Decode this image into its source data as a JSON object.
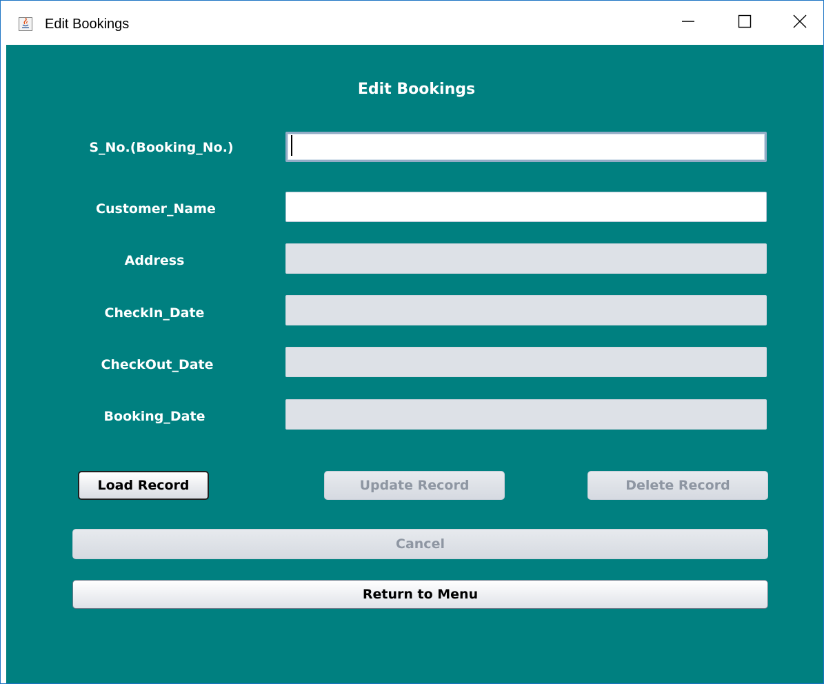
{
  "window": {
    "title": "Edit Bookings"
  },
  "form": {
    "heading": "Edit Bookings",
    "fields": [
      {
        "label": "S_No.(Booking_No.)",
        "value": ""
      },
      {
        "label": "Customer_Name",
        "value": ""
      },
      {
        "label": "Address",
        "value": ""
      },
      {
        "label": "CheckIn_Date",
        "value": ""
      },
      {
        "label": "CheckOut_Date",
        "value": ""
      },
      {
        "label": "Booking_Date",
        "value": ""
      }
    ]
  },
  "buttons": {
    "load": "Load Record",
    "update": "Update Record",
    "delete": "Delete Record",
    "cancel": "Cancel",
    "return_menu": "Return to Menu"
  },
  "colors": {
    "background": "#008080",
    "label_text": "#ffffff",
    "disabled_field": "#dde1e7"
  },
  "icons": {
    "app": "java-coffee-icon",
    "minimize": "minimize-icon",
    "maximize": "maximize-icon",
    "close": "close-icon"
  }
}
